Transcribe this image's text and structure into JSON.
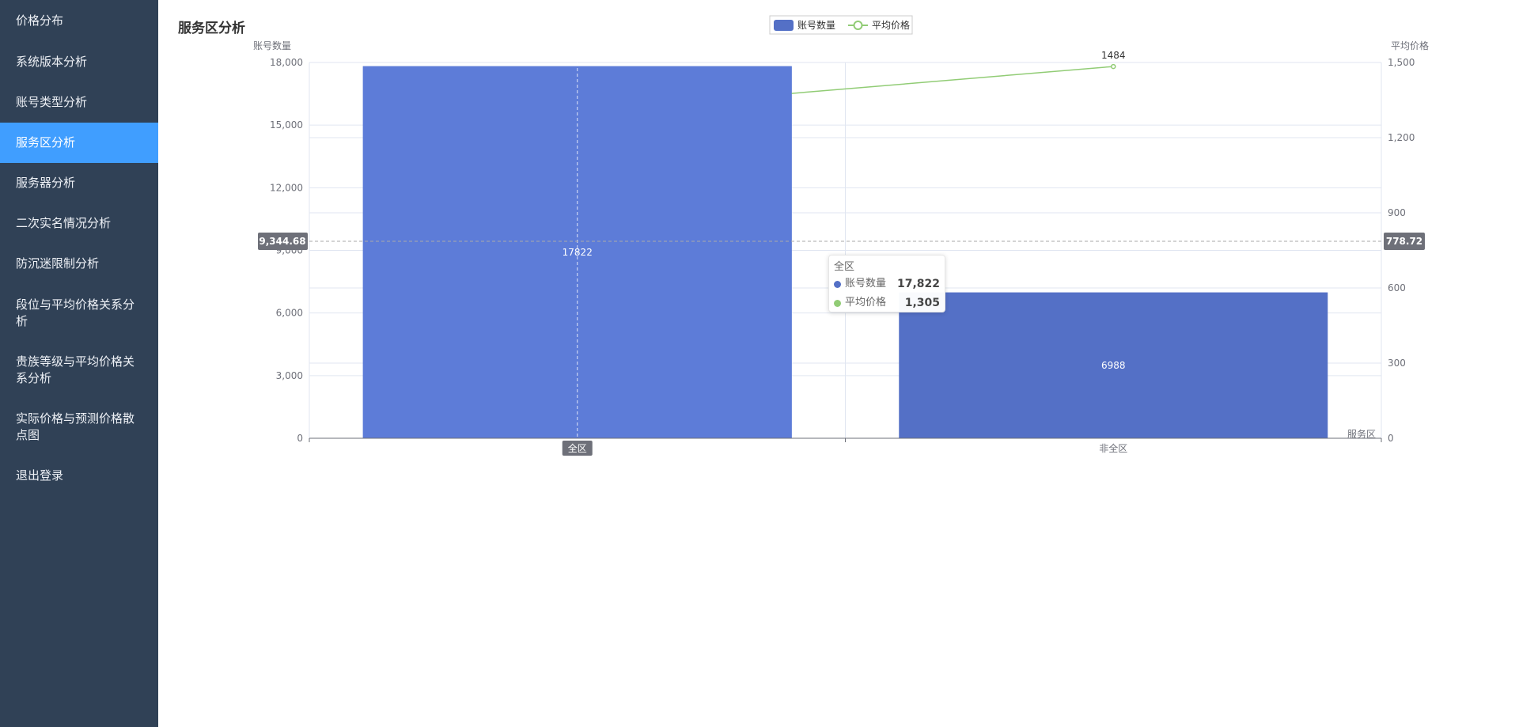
{
  "sidebar": {
    "items": [
      {
        "label": "价格分布"
      },
      {
        "label": "系统版本分析"
      },
      {
        "label": "账号类型分析"
      },
      {
        "label": "服务区分析",
        "active": true
      },
      {
        "label": "服务器分析"
      },
      {
        "label": "二次实名情况分析"
      },
      {
        "label": "防沉迷限制分析"
      },
      {
        "label": "段位与平均价格关系分析"
      },
      {
        "label": "贵族等级与平均价格关系分析"
      },
      {
        "label": "实际价格与预测价格散点图"
      },
      {
        "label": "退出登录"
      }
    ]
  },
  "page": {
    "title": "服务区分析"
  },
  "colors": {
    "bar": "#5470c6",
    "line": "#91cc75",
    "sidebar": "#304156",
    "active": "#409eff"
  },
  "chart_data": {
    "type": "bar",
    "categories": [
      "全区",
      "非全区"
    ],
    "series": [
      {
        "name": "账号数量",
        "type": "bar",
        "axis": "left",
        "values": [
          17822,
          6988
        ]
      },
      {
        "name": "平均价格",
        "type": "line",
        "axis": "right",
        "values": [
          1305,
          1484
        ]
      }
    ],
    "ylabel_left": "账号数量",
    "ylabel_right": "平均价格",
    "xlabel": "服务区",
    "ylim_left": [
      0,
      18000
    ],
    "ylim_right": [
      0,
      1500
    ],
    "yticks_left": [
      "0",
      "3,000",
      "6,000",
      "9,000",
      "12,000",
      "15,000",
      "18,000"
    ],
    "yticks_right": [
      "0",
      "300",
      "600",
      "900",
      "1,200",
      "1,500"
    ],
    "bar_labels": [
      "17822",
      "6988"
    ],
    "line_labels": [
      "",
      "1484"
    ],
    "legend_position": "top-center",
    "crosshair": {
      "x_category": "全区",
      "left_value": "9,344.68",
      "right_value": "778.72"
    },
    "tooltip": {
      "title": "全区",
      "rows": [
        {
          "name": "账号数量",
          "value": "17,822"
        },
        {
          "name": "平均价格",
          "value": "1,305"
        }
      ]
    }
  }
}
